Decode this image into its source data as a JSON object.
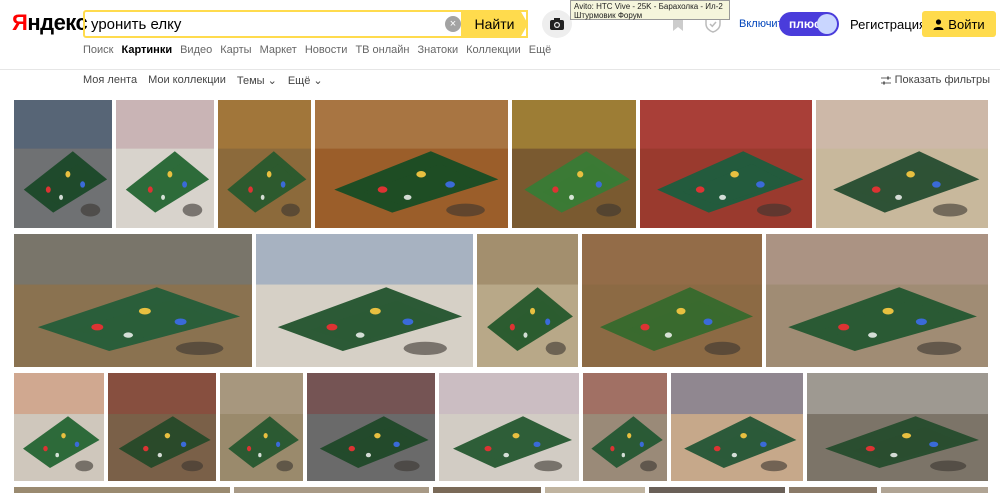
{
  "logo": {
    "first": "Я",
    "rest": "ндекс"
  },
  "search": {
    "value": "уронить елку",
    "button": "Найти",
    "clear": "×"
  },
  "tooltip": {
    "line1": "Avito: HTC Vive - 25K - Барахолка - Ил-2",
    "line2": "Штурмовик Форум"
  },
  "header": {
    "enable": "Включить",
    "plus": "плюс",
    "register": "Регистрация",
    "login": "Войти"
  },
  "nav": [
    {
      "label": "Поиск",
      "active": false
    },
    {
      "label": "Картинки",
      "active": true
    },
    {
      "label": "Видео",
      "active": false
    },
    {
      "label": "Карты",
      "active": false
    },
    {
      "label": "Маркет",
      "active": false
    },
    {
      "label": "Новости",
      "active": false
    },
    {
      "label": "ТВ онлайн",
      "active": false
    },
    {
      "label": "Знатоки",
      "active": false
    },
    {
      "label": "Коллекции",
      "active": false
    },
    {
      "label": "Ещё",
      "active": false
    }
  ],
  "subbar": {
    "feed": "Моя лента",
    "collections": "Мои коллекции",
    "themes": "Темы",
    "more": "Ещё",
    "filters": "Показать фильтры"
  },
  "colors": {
    "accent": "#ffdb4d",
    "link": "#0044bb",
    "plus": "#4a3cdb"
  },
  "image_results": [
    {
      "floor": "#6f7173",
      "tree": "#1f4a2c",
      "tone": "#2b4f7a"
    },
    {
      "floor": "#d8d3cc",
      "tree": "#2d6b3a",
      "tone": "#b07a8a"
    },
    {
      "floor": "#8c6a3b",
      "tree": "#2d5a2e",
      "tone": "#c88b3a"
    },
    {
      "floor": "#9b5e2a",
      "tree": "#1e4d24",
      "tone": "#c0a070"
    },
    {
      "floor": "#7a5a30",
      "tree": "#3b7a35",
      "tone": "#e0c040"
    },
    {
      "floor": "#9a3a2e",
      "tree": "#235b3d",
      "tone": "#c74a4a"
    },
    {
      "floor": "#c8b89c",
      "tree": "#2e5236",
      "tone": "#d8b8c0"
    },
    {
      "floor": "#8a7250",
      "tree": "#2a5e3a",
      "tone": "#5a7a9a"
    },
    {
      "floor": "#d6d0c6",
      "tree": "#2c5a36",
      "tone": "#4f7ab8"
    },
    {
      "floor": "#b8a888",
      "tree": "#2c5c30",
      "tone": "#7a6040"
    },
    {
      "floor": "#8c6a44",
      "tree": "#3a6a2e",
      "tone": "#a07050"
    },
    {
      "floor": "#a08c74",
      "tree": "#2a5a34",
      "tone": "#c0a0a0"
    },
    {
      "floor": "#cfc7bc",
      "tree": "#2d6a3a",
      "tone": "#d07040"
    },
    {
      "floor": "#7a6048",
      "tree": "#2a4a2a",
      "tone": "#a03030"
    },
    {
      "floor": "#9a8a6c",
      "tree": "#2c5a32",
      "tone": "#c0b0a0"
    },
    {
      "floor": "#6a6a6a",
      "tree": "#234a2c",
      "tone": "#8a2a2a"
    },
    {
      "floor": "#d2ccc4",
      "tree": "#2e5e38",
      "tone": "#c0a0c0"
    },
    {
      "floor": "#9a8a78",
      "tree": "#2a5a36",
      "tone": "#b04040"
    },
    {
      "floor": "#c6a88a",
      "tree": "#2c5a3a",
      "tone": "#2a4a9a"
    },
    {
      "floor": "#7c7468",
      "tree": "#2a4e30",
      "tone": "#e0e0e0"
    }
  ]
}
